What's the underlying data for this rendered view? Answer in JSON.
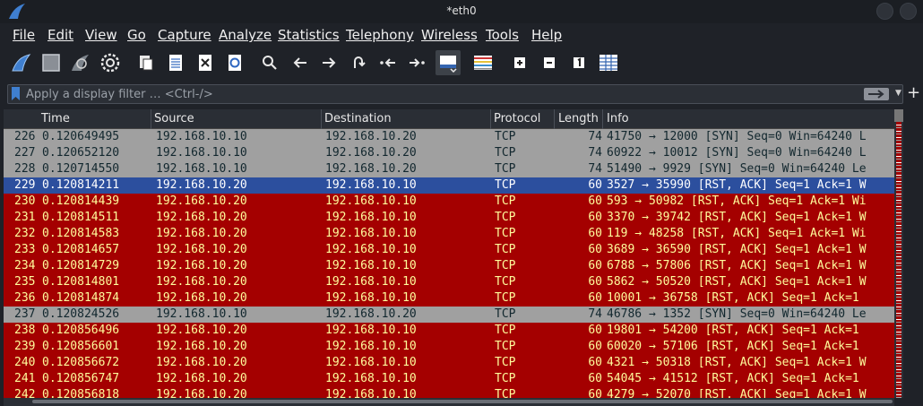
{
  "window": {
    "title": "*eth0"
  },
  "menu": [
    "File",
    "Edit",
    "View",
    "Go",
    "Capture",
    "Analyze",
    "Statistics",
    "Telephony",
    "Wireless",
    "Tools",
    "Help"
  ],
  "filter": {
    "placeholder": "Apply a display filter … <Ctrl-/>"
  },
  "columns": [
    "Time",
    "Source",
    "Destination",
    "Protocol",
    "Length",
    "Info"
  ],
  "colors": {
    "syn_row": "#a0a0a0",
    "rst_row": "#a40000",
    "selected_row": "#2c4f9e",
    "rst_text": "#fffc9c"
  },
  "packets": [
    {
      "no": "226",
      "time": "0.120649495",
      "src": "192.168.10.10",
      "dst": "192.168.10.20",
      "proto": "TCP",
      "len": "74",
      "info": "41750 → 12000 [SYN] Seq=0 Win=64240 L",
      "style": "syn"
    },
    {
      "no": "227",
      "time": "0.120652120",
      "src": "192.168.10.10",
      "dst": "192.168.10.20",
      "proto": "TCP",
      "len": "74",
      "info": "60922 → 10012 [SYN] Seq=0 Win=64240 L",
      "style": "syn"
    },
    {
      "no": "228",
      "time": "0.120714550",
      "src": "192.168.10.10",
      "dst": "192.168.10.20",
      "proto": "TCP",
      "len": "74",
      "info": "51490 → 9929 [SYN] Seq=0 Win=64240 Le",
      "style": "syn"
    },
    {
      "no": "229",
      "time": "0.120814211",
      "src": "192.168.10.20",
      "dst": "192.168.10.10",
      "proto": "TCP",
      "len": "60",
      "info": "3527 → 35990 [RST, ACK] Seq=1 Ack=1 W",
      "style": "sel"
    },
    {
      "no": "230",
      "time": "0.120814439",
      "src": "192.168.10.20",
      "dst": "192.168.10.10",
      "proto": "TCP",
      "len": "60",
      "info": "593 → 50982 [RST, ACK] Seq=1 Ack=1 Wi",
      "style": "rst"
    },
    {
      "no": "231",
      "time": "0.120814511",
      "src": "192.168.10.20",
      "dst": "192.168.10.10",
      "proto": "TCP",
      "len": "60",
      "info": "3370 → 39742 [RST, ACK] Seq=1 Ack=1 W",
      "style": "rst"
    },
    {
      "no": "232",
      "time": "0.120814583",
      "src": "192.168.10.20",
      "dst": "192.168.10.10",
      "proto": "TCP",
      "len": "60",
      "info": "119 → 48258 [RST, ACK] Seq=1 Ack=1 Wi",
      "style": "rst"
    },
    {
      "no": "233",
      "time": "0.120814657",
      "src": "192.168.10.20",
      "dst": "192.168.10.10",
      "proto": "TCP",
      "len": "60",
      "info": "3689 → 36590 [RST, ACK] Seq=1 Ack=1 W",
      "style": "rst"
    },
    {
      "no": "234",
      "time": "0.120814729",
      "src": "192.168.10.20",
      "dst": "192.168.10.10",
      "proto": "TCP",
      "len": "60",
      "info": "6788 → 57806 [RST, ACK] Seq=1 Ack=1 W",
      "style": "rst"
    },
    {
      "no": "235",
      "time": "0.120814801",
      "src": "192.168.10.20",
      "dst": "192.168.10.10",
      "proto": "TCP",
      "len": "60",
      "info": "5862 → 50520 [RST, ACK] Seq=1 Ack=1 W",
      "style": "rst"
    },
    {
      "no": "236",
      "time": "0.120814874",
      "src": "192.168.10.20",
      "dst": "192.168.10.10",
      "proto": "TCP",
      "len": "60",
      "info": "10001 → 36758 [RST, ACK] Seq=1 Ack=1",
      "style": "rst"
    },
    {
      "no": "237",
      "time": "0.120824526",
      "src": "192.168.10.10",
      "dst": "192.168.10.20",
      "proto": "TCP",
      "len": "74",
      "info": "46786 → 1352 [SYN] Seq=0 Win=64240 Le",
      "style": "syn"
    },
    {
      "no": "238",
      "time": "0.120856496",
      "src": "192.168.10.20",
      "dst": "192.168.10.10",
      "proto": "TCP",
      "len": "60",
      "info": "19801 → 54200 [RST, ACK] Seq=1 Ack=1",
      "style": "rst"
    },
    {
      "no": "239",
      "time": "0.120856601",
      "src": "192.168.10.20",
      "dst": "192.168.10.10",
      "proto": "TCP",
      "len": "60",
      "info": "60020 → 57106 [RST, ACK] Seq=1 Ack=1",
      "style": "rst"
    },
    {
      "no": "240",
      "time": "0.120856672",
      "src": "192.168.10.20",
      "dst": "192.168.10.10",
      "proto": "TCP",
      "len": "60",
      "info": "4321 → 50318 [RST, ACK] Seq=1 Ack=1 W",
      "style": "rst"
    },
    {
      "no": "241",
      "time": "0.120856747",
      "src": "192.168.10.20",
      "dst": "192.168.10.10",
      "proto": "TCP",
      "len": "60",
      "info": "54045 → 41512 [RST, ACK] Seq=1 Ack=1",
      "style": "rst"
    },
    {
      "no": "242",
      "time": "0.120856818",
      "src": "192.168.10.20",
      "dst": "192.168.10.10",
      "proto": "TCP",
      "len": "60",
      "info": "4279 → 52070 [RST, ACK] Seq=1 Ack=1 W",
      "style": "rst"
    }
  ]
}
